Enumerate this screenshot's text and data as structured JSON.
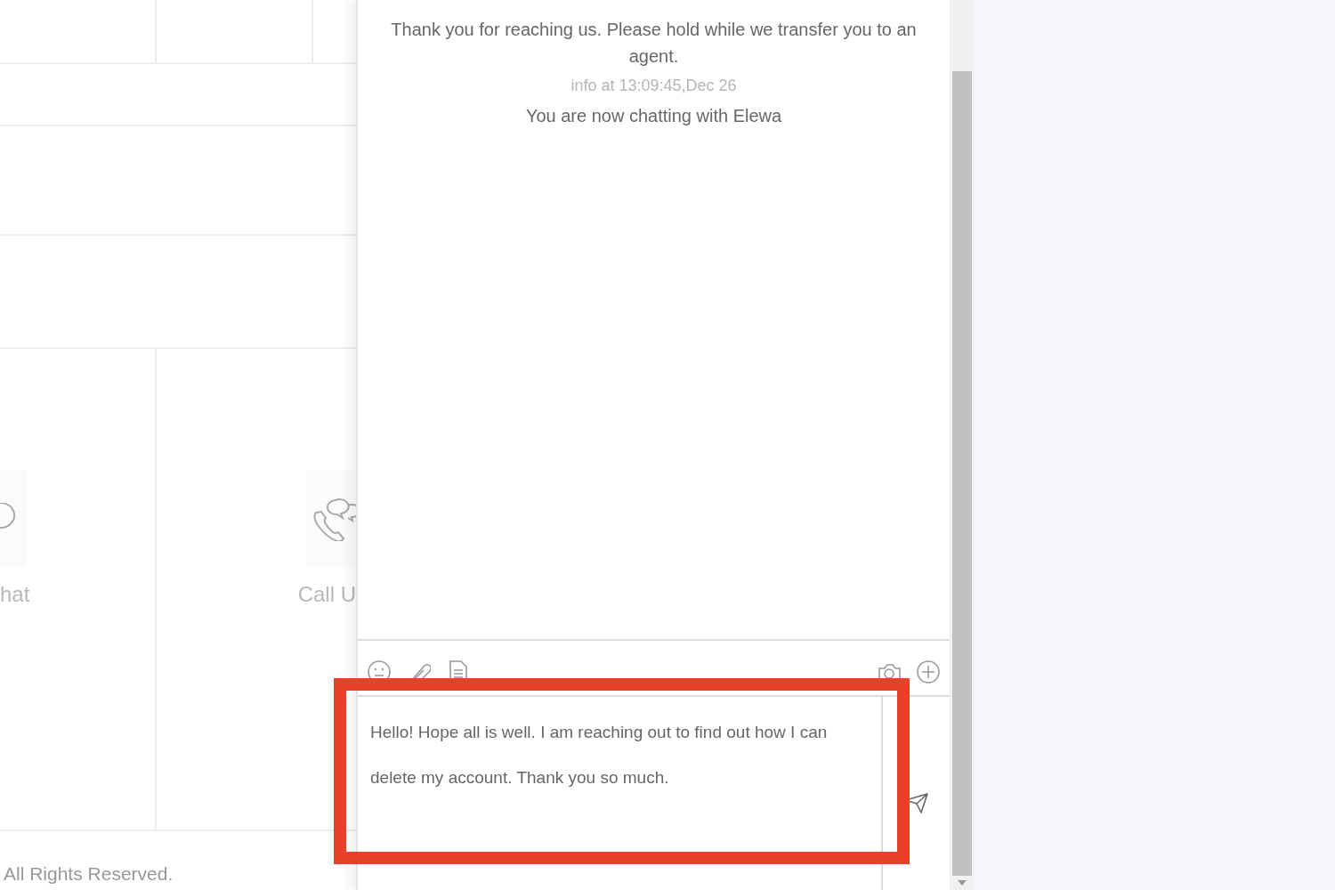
{
  "background_page": {
    "cards": [
      {
        "kind": "chat",
        "label": "hat"
      },
      {
        "kind": "call",
        "label": "Call U"
      }
    ],
    "footer": "All Rights Reserved."
  },
  "chat": {
    "messages": [
      {
        "kind": "text",
        "text": "Thank you for reaching us. Please hold while we transfer you to an agent."
      },
      {
        "kind": "meta",
        "text": "info at 13:09:45,Dec 26"
      },
      {
        "kind": "text",
        "text": "You are now chatting with Elewa"
      }
    ],
    "toolbar": {
      "left": [
        {
          "kind": "emoji"
        },
        {
          "kind": "attach"
        },
        {
          "kind": "document"
        }
      ],
      "right": [
        {
          "kind": "camera"
        },
        {
          "kind": "plus"
        }
      ]
    },
    "composer": {
      "value": "Hello! Hope all is well. I am reaching out to find out how I can delete my account. Thank you so much.",
      "highlighted": true
    }
  }
}
